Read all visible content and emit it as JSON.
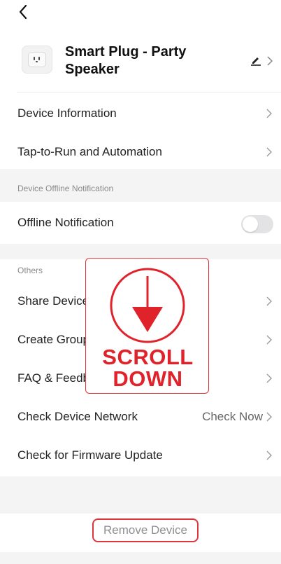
{
  "header": {
    "back_icon": "chevron-left-icon",
    "device_title": "Smart Plug - Party Speaker",
    "edit_icon": "pencil-icon",
    "device_icon": "smart-plug-icon"
  },
  "main_items": [
    {
      "label": "Device Information"
    },
    {
      "label": "Tap-to-Run and Automation"
    }
  ],
  "offline_section": {
    "title": "Device Offline Notification",
    "row_label": "Offline Notification",
    "toggle_on": false
  },
  "others_section": {
    "title": "Others",
    "items": [
      {
        "label": "Share Device"
      },
      {
        "label": "Create Group"
      },
      {
        "label": "FAQ & Feedback"
      },
      {
        "label": "Check Device Network",
        "value": "Check Now"
      },
      {
        "label": "Check for Firmware Update"
      }
    ]
  },
  "overlay": {
    "line1": "SCROLL",
    "line2": "DOWN",
    "icon": "down-arrow-circle-icon",
    "accent": "#e0222b"
  },
  "footer": {
    "remove_label": "Remove Device"
  },
  "colors": {
    "background": "#f4f4f5",
    "surface": "#ffffff",
    "accent_red": "#e0343a",
    "toggle_off": "#e3e3e6"
  }
}
